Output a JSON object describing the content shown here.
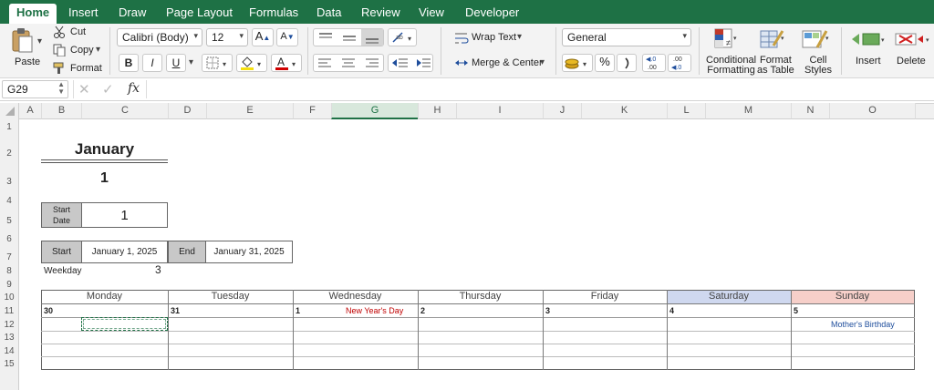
{
  "tabs": [
    "Home",
    "Insert",
    "Draw",
    "Page Layout",
    "Formulas",
    "Data",
    "Review",
    "View",
    "Developer"
  ],
  "clipboard": {
    "paste": "Paste",
    "cut": "Cut",
    "copy": "Copy",
    "format": "Format"
  },
  "font": {
    "name": "Calibri (Body)",
    "size": "12",
    "bold": "B",
    "italic": "I",
    "underline": "U"
  },
  "alignment": {
    "wrap_text": "Wrap Text",
    "merge_center": "Merge & Center"
  },
  "number": {
    "format": "General",
    "percent": "%"
  },
  "styles": {
    "conditional": [
      "Conditional",
      "Formatting"
    ],
    "format_table": [
      "Format",
      "as Table"
    ],
    "cell_styles": [
      "Cell",
      "Styles"
    ]
  },
  "cells_group": {
    "insert": "Insert",
    "delete": "Delete"
  },
  "formula_bar": {
    "name_box": "G29",
    "fx": "fx",
    "value": ""
  },
  "columns": [
    "A",
    "B",
    "C",
    "D",
    "E",
    "F",
    "G",
    "H",
    "I",
    "J",
    "K",
    "L",
    "M",
    "N",
    "O"
  ],
  "selected_column": "G",
  "rows": [
    "1",
    "2",
    "3",
    "4",
    "5",
    "6",
    "7",
    "8",
    "9",
    "10",
    "11",
    "12",
    "13",
    "14",
    "15"
  ],
  "sheet": {
    "month": "January",
    "month_number": "1",
    "start_date_label_1": "Start",
    "start_date_label_2": "Date",
    "start_date_value": "1",
    "start_label": "Start",
    "start_value": "January 1, 2025",
    "end_label": "End",
    "end_value": "January 31, 2025",
    "weekday_label": "Weekday",
    "weekday_value": "3"
  },
  "calendar": {
    "days": [
      "Monday",
      "Tuesday",
      "Wednesday",
      "Thursday",
      "Friday",
      "Saturday",
      "Sunday"
    ],
    "dates": [
      "30",
      "31",
      "1",
      "2",
      "3",
      "4",
      "5"
    ],
    "events": {
      "wednesday": "New Year's Day",
      "sunday": "Mother's Birthday"
    },
    "colors": {
      "saturday": "#cfd8ef",
      "sunday": "#f6cfc9",
      "holiday": "#c00000",
      "event": "#1f4e9c"
    }
  }
}
